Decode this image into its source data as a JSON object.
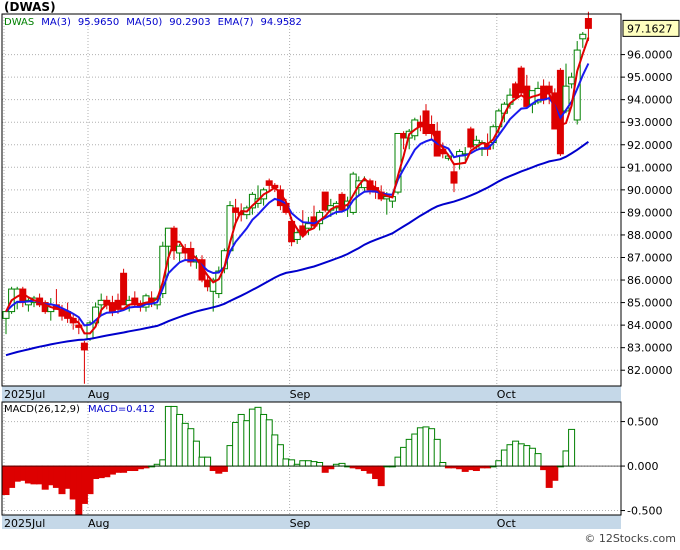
{
  "header": {
    "ticker": "(DWAS)",
    "legend": [
      {
        "text": "DWAS",
        "color": "#008000"
      },
      {
        "text": "MA(3)",
        "color": "#0000cc"
      },
      {
        "text": "95.9650",
        "color": "#0000cc"
      },
      {
        "text": "MA(50)",
        "color": "#0000cc"
      },
      {
        "text": "90.2903",
        "color": "#0000cc"
      },
      {
        "text": "EMA(7)",
        "color": "#0000cc"
      },
      {
        "text": "94.9582",
        "color": "#0000cc"
      }
    ]
  },
  "price_tag": "97.1627",
  "watermark": "© 12Stocks.com",
  "colors": {
    "up": "#008000",
    "down": "#dd0000",
    "ma3": "#e00000",
    "ma50": "#0000cc",
    "ema7": "#1a1aee",
    "grid": "#b0b0b0",
    "axis_band": "#c5d8e8",
    "tag_bg": "#ffffc0"
  },
  "chart_data": [
    {
      "type": "candlestick",
      "title": "(DWAS)",
      "x_tick_labels": [
        "2025Jul",
        "Aug",
        "Sep",
        "Oct"
      ],
      "x_tick_index": [
        0,
        15,
        51,
        88
      ],
      "ylim": [
        81.3,
        97.8
      ],
      "y_ticks": [
        82,
        83,
        84,
        85,
        86,
        87,
        88,
        89,
        90,
        91,
        92,
        93,
        94,
        95,
        96
      ],
      "y_tick_labels": [
        "82.0000",
        "83.0000",
        "84.0000",
        "85.0000",
        "86.0000",
        "87.0000",
        "88.0000",
        "89.0000",
        "90.0000",
        "91.0000",
        "92.0000",
        "93.0000",
        "94.0000",
        "95.0000",
        "96.0000"
      ],
      "last_price": 97.1627,
      "grid": true,
      "candles": [
        {
          "o": 84.3,
          "h": 84.6,
          "l": 83.6,
          "c": 84.6
        },
        {
          "o": 84.6,
          "h": 85.7,
          "l": 84.5,
          "c": 85.6
        },
        {
          "o": 85.0,
          "h": 85.7,
          "l": 84.7,
          "c": 85.6
        },
        {
          "o": 85.6,
          "h": 85.7,
          "l": 84.8,
          "c": 85.0
        },
        {
          "o": 84.9,
          "h": 85.2,
          "l": 84.6,
          "c": 85.1
        },
        {
          "o": 85.0,
          "h": 85.3,
          "l": 84.8,
          "c": 85.2
        },
        {
          "o": 85.2,
          "h": 85.4,
          "l": 84.8,
          "c": 84.9
        },
        {
          "o": 85.0,
          "h": 85.1,
          "l": 84.5,
          "c": 84.6
        },
        {
          "o": 84.6,
          "h": 85.2,
          "l": 84.2,
          "c": 84.9
        },
        {
          "o": 84.9,
          "h": 85.6,
          "l": 84.7,
          "c": 84.7
        },
        {
          "o": 84.7,
          "h": 84.9,
          "l": 84.2,
          "c": 84.4
        },
        {
          "o": 84.6,
          "h": 85.0,
          "l": 84.1,
          "c": 84.3
        },
        {
          "o": 84.3,
          "h": 84.5,
          "l": 83.8,
          "c": 84.1
        },
        {
          "o": 84.0,
          "h": 84.3,
          "l": 83.6,
          "c": 83.9
        },
        {
          "o": 83.2,
          "h": 83.3,
          "l": 81.4,
          "c": 82.9
        },
        {
          "o": 83.4,
          "h": 84.2,
          "l": 83.3,
          "c": 84.1
        },
        {
          "o": 84.1,
          "h": 85.0,
          "l": 83.9,
          "c": 84.8
        },
        {
          "o": 84.9,
          "h": 85.4,
          "l": 84.5,
          "c": 85.1
        },
        {
          "o": 85.1,
          "h": 85.3,
          "l": 84.7,
          "c": 84.9
        },
        {
          "o": 85.0,
          "h": 85.3,
          "l": 84.4,
          "c": 84.6
        },
        {
          "o": 85.1,
          "h": 85.4,
          "l": 84.5,
          "c": 84.7
        },
        {
          "o": 86.3,
          "h": 86.5,
          "l": 84.9,
          "c": 84.9
        },
        {
          "o": 84.9,
          "h": 85.3,
          "l": 84.6,
          "c": 85.1
        },
        {
          "o": 85.2,
          "h": 85.5,
          "l": 84.8,
          "c": 84.9
        },
        {
          "o": 84.9,
          "h": 85.1,
          "l": 84.6,
          "c": 84.8
        },
        {
          "o": 84.8,
          "h": 85.4,
          "l": 84.6,
          "c": 85.3
        },
        {
          "o": 85.2,
          "h": 85.5,
          "l": 84.8,
          "c": 85.0
        },
        {
          "o": 84.9,
          "h": 85.3,
          "l": 84.7,
          "c": 85.2
        },
        {
          "o": 85.4,
          "h": 87.7,
          "l": 85.2,
          "c": 87.5
        },
        {
          "o": 87.5,
          "h": 88.3,
          "l": 86.2,
          "c": 88.3
        },
        {
          "o": 88.3,
          "h": 88.4,
          "l": 86.9,
          "c": 87.3
        },
        {
          "o": 87.2,
          "h": 87.6,
          "l": 86.8,
          "c": 87.5
        },
        {
          "o": 87.4,
          "h": 87.6,
          "l": 86.9,
          "c": 87.2
        },
        {
          "o": 87.4,
          "h": 87.7,
          "l": 86.6,
          "c": 86.8
        },
        {
          "o": 86.8,
          "h": 87.1,
          "l": 86.5,
          "c": 86.9
        },
        {
          "o": 86.9,
          "h": 87.1,
          "l": 85.9,
          "c": 86.0
        },
        {
          "o": 86.0,
          "h": 86.2,
          "l": 85.5,
          "c": 85.7
        },
        {
          "o": 85.5,
          "h": 86.1,
          "l": 84.6,
          "c": 86.0
        },
        {
          "o": 85.4,
          "h": 86.6,
          "l": 85.2,
          "c": 86.4
        },
        {
          "o": 86.5,
          "h": 87.4,
          "l": 86.3,
          "c": 87.3
        },
        {
          "o": 87.3,
          "h": 89.5,
          "l": 87.2,
          "c": 89.3
        },
        {
          "o": 89.2,
          "h": 89.6,
          "l": 88.5,
          "c": 89.0
        },
        {
          "o": 89.0,
          "h": 89.4,
          "l": 88.6,
          "c": 88.9
        },
        {
          "o": 88.9,
          "h": 89.3,
          "l": 88.7,
          "c": 89.2
        },
        {
          "o": 89.2,
          "h": 89.9,
          "l": 88.9,
          "c": 89.8
        },
        {
          "o": 89.4,
          "h": 90.2,
          "l": 89.2,
          "c": 89.6
        },
        {
          "o": 89.6,
          "h": 90.1,
          "l": 89.3,
          "c": 90.0
        },
        {
          "o": 90.4,
          "h": 90.5,
          "l": 89.9,
          "c": 90.2
        },
        {
          "o": 90.2,
          "h": 90.3,
          "l": 89.9,
          "c": 90.1
        },
        {
          "o": 90.0,
          "h": 90.2,
          "l": 89.1,
          "c": 89.3
        },
        {
          "o": 89.4,
          "h": 89.6,
          "l": 88.9,
          "c": 89.0
        },
        {
          "o": 88.6,
          "h": 88.8,
          "l": 87.5,
          "c": 87.7
        },
        {
          "o": 87.8,
          "h": 88.2,
          "l": 87.6,
          "c": 88.1
        },
        {
          "o": 88.4,
          "h": 89.1,
          "l": 87.9,
          "c": 88.0
        },
        {
          "o": 88.3,
          "h": 88.8,
          "l": 88.0,
          "c": 88.5
        },
        {
          "o": 88.8,
          "h": 89.3,
          "l": 88.3,
          "c": 88.4
        },
        {
          "o": 88.5,
          "h": 89.1,
          "l": 88.2,
          "c": 89.0
        },
        {
          "o": 89.9,
          "h": 89.9,
          "l": 89.0,
          "c": 89.1
        },
        {
          "o": 89.1,
          "h": 89.6,
          "l": 88.8,
          "c": 89.3
        },
        {
          "o": 89.2,
          "h": 89.5,
          "l": 88.9,
          "c": 89.4
        },
        {
          "o": 89.8,
          "h": 89.9,
          "l": 89.0,
          "c": 89.1
        },
        {
          "o": 89.3,
          "h": 89.7,
          "l": 88.8,
          "c": 89.5
        },
        {
          "o": 89.0,
          "h": 90.8,
          "l": 88.9,
          "c": 90.7
        },
        {
          "o": 90.1,
          "h": 90.6,
          "l": 89.7,
          "c": 90.4
        },
        {
          "o": 90.1,
          "h": 90.6,
          "l": 89.9,
          "c": 90.4
        },
        {
          "o": 90.4,
          "h": 90.5,
          "l": 89.8,
          "c": 90.0
        },
        {
          "o": 90.1,
          "h": 90.4,
          "l": 89.6,
          "c": 89.9
        },
        {
          "o": 89.9,
          "h": 90.2,
          "l": 89.5,
          "c": 89.6
        },
        {
          "o": 89.6,
          "h": 89.9,
          "l": 88.9,
          "c": 89.7
        },
        {
          "o": 89.5,
          "h": 89.8,
          "l": 89.2,
          "c": 89.7
        },
        {
          "o": 89.9,
          "h": 92.5,
          "l": 89.8,
          "c": 92.5
        },
        {
          "o": 92.5,
          "h": 92.6,
          "l": 91.8,
          "c": 92.3
        },
        {
          "o": 92.3,
          "h": 92.7,
          "l": 91.8,
          "c": 92.6
        },
        {
          "o": 92.4,
          "h": 93.2,
          "l": 92.2,
          "c": 93.1
        },
        {
          "o": 93.0,
          "h": 93.3,
          "l": 92.6,
          "c": 92.8
        },
        {
          "o": 93.5,
          "h": 93.8,
          "l": 92.4,
          "c": 92.5
        },
        {
          "o": 92.9,
          "h": 93.3,
          "l": 92.2,
          "c": 92.5
        },
        {
          "o": 92.6,
          "h": 93.0,
          "l": 91.5,
          "c": 91.5
        },
        {
          "o": 91.8,
          "h": 92.1,
          "l": 91.4,
          "c": 91.6
        },
        {
          "o": 91.4,
          "h": 91.6,
          "l": 91.3,
          "c": 91.5
        },
        {
          "o": 90.8,
          "h": 91.2,
          "l": 89.9,
          "c": 90.3
        },
        {
          "o": 91.5,
          "h": 91.8,
          "l": 90.9,
          "c": 91.7
        },
        {
          "o": 91.6,
          "h": 91.9,
          "l": 91.3,
          "c": 91.6
        },
        {
          "o": 92.7,
          "h": 92.8,
          "l": 91.8,
          "c": 91.9
        },
        {
          "o": 92.0,
          "h": 92.4,
          "l": 91.8,
          "c": 92.2
        },
        {
          "o": 91.8,
          "h": 92.2,
          "l": 91.5,
          "c": 92.1
        },
        {
          "o": 92.0,
          "h": 92.5,
          "l": 91.5,
          "c": 91.8
        },
        {
          "o": 92.1,
          "h": 92.9,
          "l": 91.8,
          "c": 92.8
        },
        {
          "o": 92.8,
          "h": 93.6,
          "l": 92.5,
          "c": 93.5
        },
        {
          "o": 93.4,
          "h": 93.9,
          "l": 93.0,
          "c": 93.8
        },
        {
          "o": 93.8,
          "h": 94.5,
          "l": 93.6,
          "c": 94.2
        },
        {
          "o": 94.7,
          "h": 94.8,
          "l": 94.0,
          "c": 94.1
        },
        {
          "o": 95.4,
          "h": 95.5,
          "l": 94.2,
          "c": 94.3
        },
        {
          "o": 94.6,
          "h": 95.1,
          "l": 93.6,
          "c": 93.7
        },
        {
          "o": 93.8,
          "h": 94.4,
          "l": 93.4,
          "c": 94.4
        },
        {
          "o": 93.9,
          "h": 94.8,
          "l": 93.8,
          "c": 94.5
        },
        {
          "o": 94.6,
          "h": 94.9,
          "l": 93.8,
          "c": 94.0
        },
        {
          "o": 94.6,
          "h": 94.8,
          "l": 93.8,
          "c": 94.3
        },
        {
          "o": 94.3,
          "h": 94.5,
          "l": 92.7,
          "c": 92.7
        },
        {
          "o": 95.3,
          "h": 95.4,
          "l": 91.5,
          "c": 91.6
        },
        {
          "o": 93.5,
          "h": 95.6,
          "l": 93.4,
          "c": 94.6
        },
        {
          "o": 94.7,
          "h": 95.2,
          "l": 94.5,
          "c": 95.0
        },
        {
          "o": 93.1,
          "h": 96.6,
          "l": 92.9,
          "c": 96.2
        },
        {
          "o": 96.7,
          "h": 97.0,
          "l": 96.3,
          "c": 96.9
        },
        {
          "o": 97.6,
          "h": 97.9,
          "l": 96.6,
          "c": 97.1627
        }
      ],
      "lines": [
        {
          "name": "MA(3)",
          "color": "#e00000"
        },
        {
          "name": "MA(50)",
          "color": "#0000cc"
        },
        {
          "name": "EMA(7)",
          "color": "#1a1aee"
        }
      ]
    },
    {
      "type": "bar",
      "title": "MACD(26,12,9)",
      "legend": [
        {
          "text": "MACD(26,12,9)",
          "color": "#000000"
        },
        {
          "text": "MACD=0.412",
          "color": "#0000cc"
        }
      ],
      "ylim": [
        -0.55,
        0.72
      ],
      "y_ticks": [
        0.5,
        0.0,
        -0.5
      ],
      "y_tick_labels": [
        "0.500",
        "0.000",
        "-0.500"
      ],
      "x_tick_labels": [
        "2025Jul",
        "Aug",
        "Sep",
        "Oct"
      ],
      "grid": true,
      "values": [
        -0.32,
        -0.24,
        -0.17,
        -0.16,
        -0.19,
        -0.2,
        -0.2,
        -0.26,
        -0.21,
        -0.24,
        -0.31,
        -0.25,
        -0.37,
        -0.55,
        -0.42,
        -0.31,
        -0.14,
        -0.13,
        -0.12,
        -0.09,
        -0.07,
        -0.07,
        -0.05,
        -0.05,
        -0.03,
        -0.02,
        0.0,
        0.02,
        0.07,
        0.67,
        0.67,
        0.58,
        0.48,
        0.42,
        0.28,
        0.1,
        0.1,
        -0.05,
        -0.08,
        -0.06,
        0.23,
        0.49,
        0.58,
        0.51,
        0.64,
        0.66,
        0.58,
        0.52,
        0.35,
        0.24,
        0.08,
        0.07,
        0.02,
        0.06,
        0.06,
        0.05,
        0.04,
        -0.07,
        -0.03,
        0.02,
        0.03,
        0.0,
        -0.02,
        -0.03,
        -0.05,
        -0.08,
        -0.14,
        -0.22,
        0.0,
        0.0,
        0.1,
        0.21,
        0.3,
        0.36,
        0.43,
        0.44,
        0.42,
        0.3,
        0.04,
        -0.02,
        -0.02,
        -0.03,
        -0.06,
        -0.04,
        -0.05,
        -0.02,
        -0.02,
        0.0,
        0.06,
        0.18,
        0.24,
        0.28,
        0.25,
        0.23,
        0.2,
        0.14,
        -0.04,
        -0.24,
        -0.16,
        0.0,
        0.17,
        0.412
      ]
    }
  ]
}
